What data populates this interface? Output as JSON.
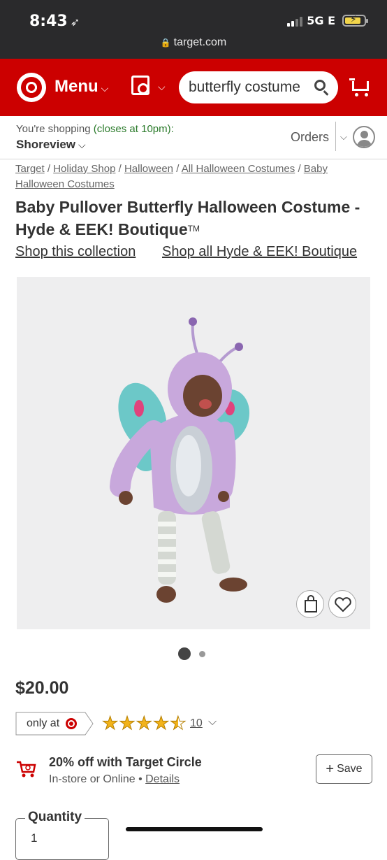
{
  "status_bar": {
    "time": "8:43",
    "network": "5G E"
  },
  "browser": {
    "url": "target.com"
  },
  "header": {
    "menu_label": "Menu",
    "search_value": "butterfly costume"
  },
  "store": {
    "shopping_prefix": "You're shopping",
    "closes_text": "(closes at 10pm):",
    "store_name": "Shoreview",
    "orders_label": "Orders"
  },
  "breadcrumb": {
    "items": [
      "Target",
      "Holiday Shop",
      "Halloween",
      "All Halloween Costumes",
      "Baby Halloween Costumes"
    ],
    "separator": "/"
  },
  "product": {
    "title": "Baby Pullover Butterfly Halloween Costume - Hyde & EEK! Boutique",
    "trademark": "TM",
    "shop_collection": "Shop this collection",
    "shop_brand": "Shop all Hyde & EEK! Boutique",
    "price": "$20.00",
    "only_at": "only at",
    "rating": 4.5,
    "review_count": "10",
    "image_count": 2,
    "active_image": 1
  },
  "promo": {
    "title": "20% off with Target Circle",
    "subtitle": "In-store or Online",
    "bullet": "•",
    "details_link": "Details",
    "save_label": "Save"
  },
  "quantity": {
    "label": "Quantity",
    "value": "1"
  },
  "colors": {
    "brand_red": "#cc0000",
    "status_bar": "#2a2a2c",
    "star": "#f2b31b",
    "closes_green": "#2a7a2a"
  }
}
